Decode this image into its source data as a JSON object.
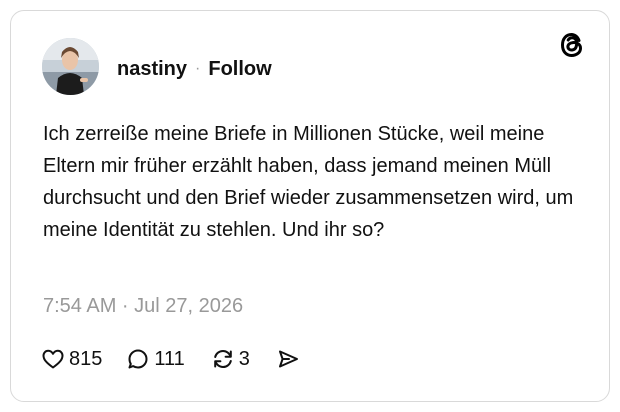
{
  "post": {
    "username": "nastiny",
    "separator": "·",
    "follow_label": "Follow",
    "text": "Ich zerreiße meine Briefe in Millionen Stücke, weil meine Eltern mir früher erzählt haben, dass jemand meinen Müll durchsucht und den Brief wieder zusammensetzen wird, um meine Identität zu stehlen. Und ihr so?",
    "timestamp": "7:54 AM · Jul 27, 2026"
  },
  "actions": {
    "likes": "815",
    "replies": "111",
    "reposts": "3"
  },
  "icons": {
    "brand": "threads-logo-icon",
    "like": "heart-icon",
    "reply": "speech-bubble-icon",
    "repost": "repost-icon",
    "share": "send-icon"
  },
  "colors": {
    "text": "#111111",
    "muted": "#999999",
    "border": "#d9d9d9"
  }
}
